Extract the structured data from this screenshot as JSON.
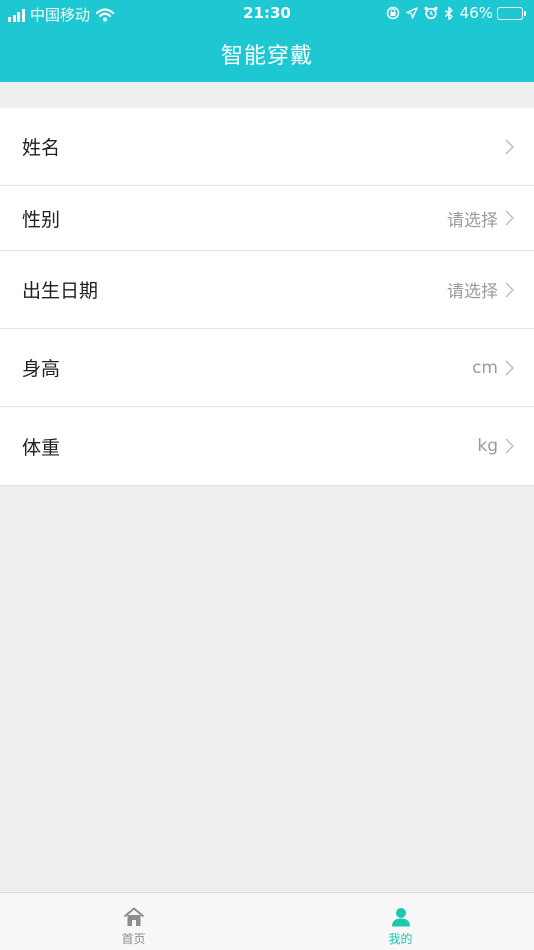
{
  "status_bar": {
    "carrier": "中国移动",
    "time": "21:30",
    "battery": "46%",
    "battery_level": 0.46
  },
  "header": {
    "title": "智能穿戴"
  },
  "rows": [
    {
      "label": "姓名",
      "value": ""
    },
    {
      "label": "性别",
      "value": "请选择"
    },
    {
      "label": "出生日期",
      "value": "请选择"
    },
    {
      "label": "身高",
      "value": "cm"
    },
    {
      "label": "体重",
      "value": "kg"
    }
  ],
  "tabbar": {
    "home_label": "首页",
    "mine_label": "我的"
  },
  "colors": {
    "accent": "#1ec8d2",
    "active_tab": "#1ec8b0",
    "inactive_tab": "#8e8e8e"
  }
}
